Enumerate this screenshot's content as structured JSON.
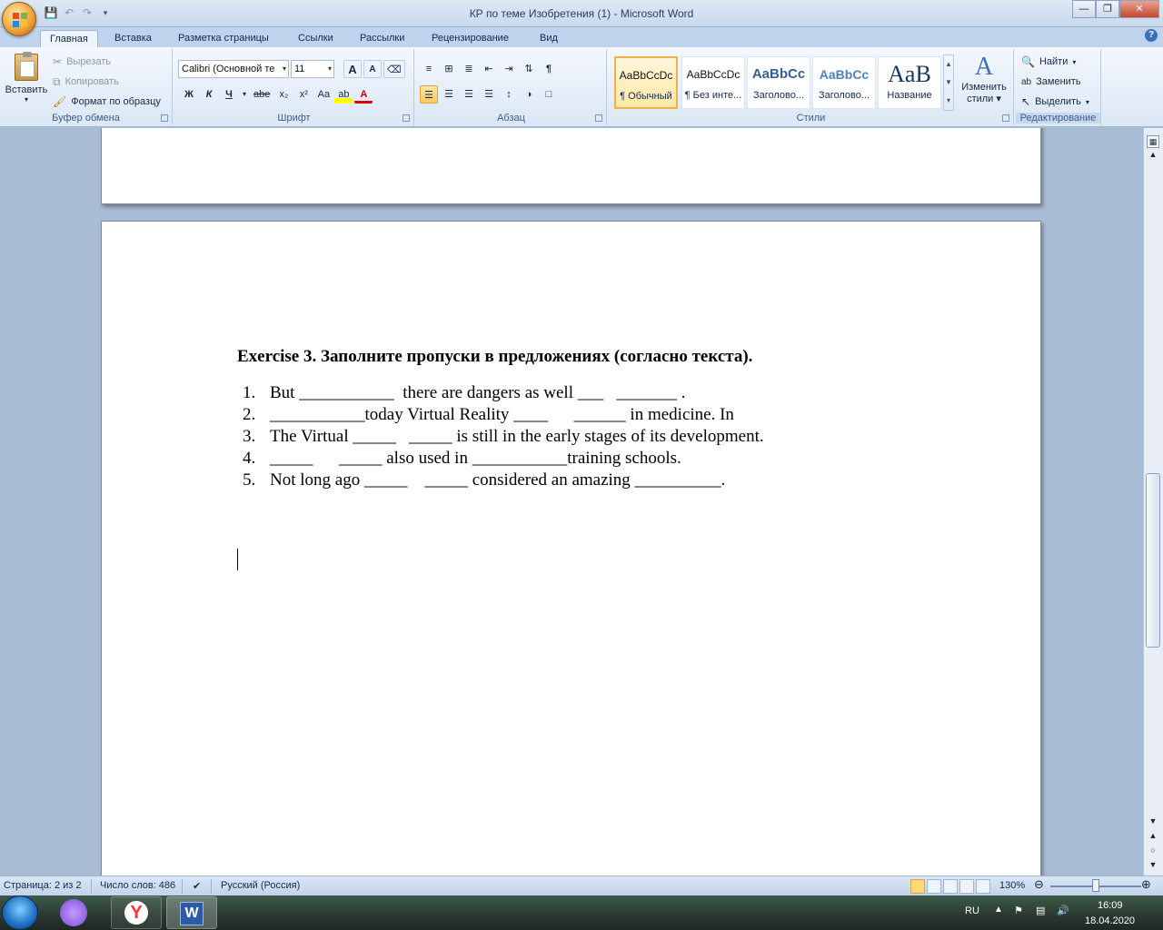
{
  "window": {
    "title": "КР по теме Изобретения (1) - Microsoft Word"
  },
  "ribbon_tabs": [
    "Главная",
    "Вставка",
    "Разметка страницы",
    "Ссылки",
    "Рассылки",
    "Рецензирование",
    "Вид"
  ],
  "clipboard": {
    "paste": "Вставить",
    "cut": "Вырезать",
    "copy": "Копировать",
    "format_painter": "Формат по образцу",
    "label": "Буфер обмена"
  },
  "font": {
    "name": "Calibri (Основной те",
    "size": "11",
    "label": "Шрифт",
    "bold": "Ж",
    "italic": "К",
    "underline": "Ч",
    "strike": "abe",
    "subscript": "x₂",
    "superscript": "x²",
    "case": "Aa",
    "grow": "A",
    "shrink": "A"
  },
  "paragraph": {
    "label": "Абзац",
    "show_marks": "¶"
  },
  "styles": {
    "label": "Стили",
    "items": [
      {
        "sample": "AaBbCcDc",
        "name": "¶ Обычный",
        "selected": true
      },
      {
        "sample": "AaBbCcDc",
        "name": "¶ Без инте...",
        "selected": false
      },
      {
        "sample": "AaBbCc",
        "name": "Заголово...",
        "selected": false
      },
      {
        "sample": "AaBbCc",
        "name": "Заголово...",
        "selected": false
      },
      {
        "sample": "AaB",
        "name": "Название",
        "selected": false
      }
    ],
    "change_styles": "Изменить",
    "change_styles_2": "стили"
  },
  "editing": {
    "label": "Редактирование",
    "find": "Найти",
    "replace": "Заменить",
    "select": "Выделить"
  },
  "document": {
    "exercise_title": "Exercise 3. Заполните пропуски в предложениях (согласно текста).",
    "items": [
      {
        "num": "1.",
        "text": "But ___________  there are dangers as well ___   _______ ."
      },
      {
        "num": "2.",
        "text": "___________today Virtual Reality ____      ______ in medicine. In"
      },
      {
        "num": "3.",
        "text": "The Virtual _____   _____ is still in the early stages of its development."
      },
      {
        "num": "4.",
        "text": "_____      _____ also used in ___________training schools."
      },
      {
        "num": "5.",
        "text": "Not long ago _____    _____ considered an amazing __________."
      }
    ]
  },
  "status": {
    "page": "Страница: 2 из 2",
    "words": "Число слов: 486",
    "language": "Русский (Россия)",
    "zoom": "130%",
    "zoom_level_percent": 130
  },
  "taskbar": {
    "lang": "RU",
    "time": "16:09",
    "date": "18.04.2020"
  },
  "colors": {
    "ribbon_bg": "#dbe7f5",
    "doc_bg": "#a9bcd6",
    "selected_style": "#f2b04a"
  }
}
